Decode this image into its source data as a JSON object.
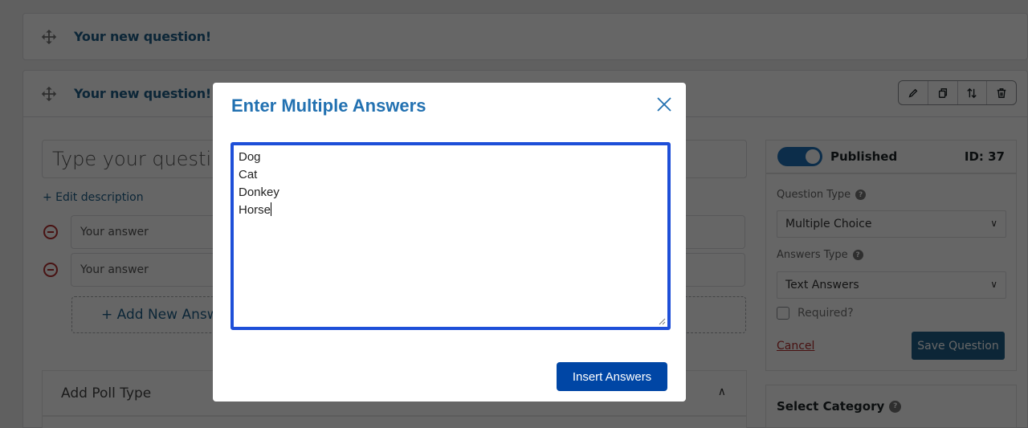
{
  "questions": [
    {
      "title": "Your new question!"
    },
    {
      "title": "Your new question!"
    }
  ],
  "toolbar": {
    "icons": [
      "pencil-icon",
      "duplicate-icon",
      "sort-icon",
      "trash-icon"
    ]
  },
  "editor": {
    "question_placeholder": "Type your question",
    "edit_description": "+ Edit description",
    "answers": [
      {
        "placeholder": "Your answer"
      },
      {
        "placeholder": "Your answer"
      }
    ],
    "add_answer_label": "+ Add New Answer",
    "poll_type_label": "Add Poll Type"
  },
  "sidebar": {
    "published_label": "Published",
    "published": true,
    "id_label": "ID: 37",
    "question_type_label": "Question Type",
    "question_type_value": "Multiple Choice",
    "answers_type_label": "Answers Type",
    "answers_type_value": "Text Answers",
    "required_label": "Required?",
    "required_checked": false,
    "cancel_label": "Cancel",
    "save_label": "Save Question",
    "category_label": "Select Category"
  },
  "modal": {
    "title": "Enter Multiple Answers",
    "lines": [
      "Dog",
      "Cat",
      "Donkey",
      "Horse"
    ],
    "insert_label": "Insert Answers"
  },
  "colors": {
    "accent": "#2271b1",
    "primary_button": "#0046a5",
    "focus_border": "#1e4fd8",
    "danger": "#b32d2e",
    "overlay": "rgba(0,0,0,0.6)"
  }
}
